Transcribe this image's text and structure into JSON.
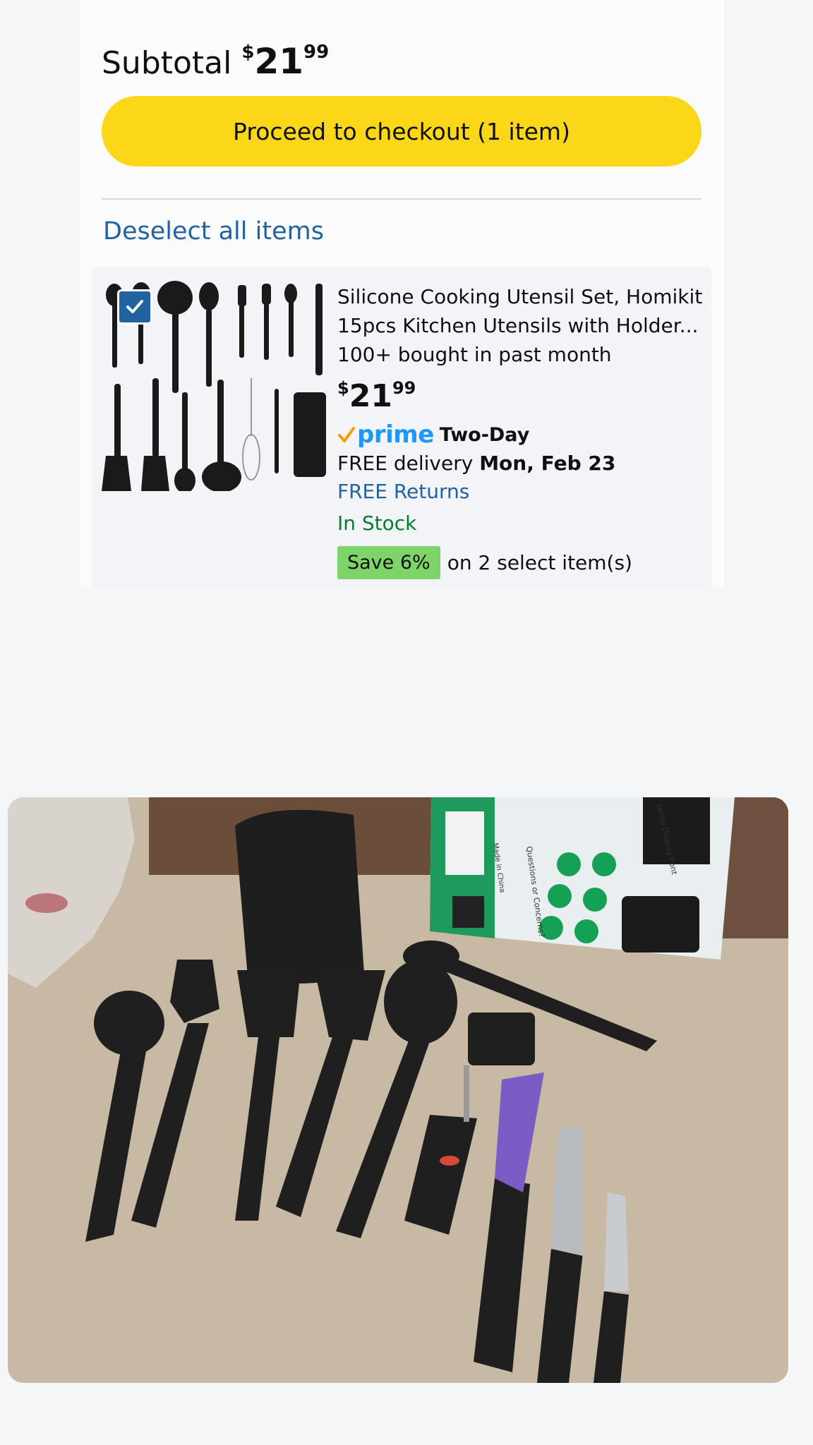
{
  "cart": {
    "subtotal_label": "Subtotal",
    "subtotal_currency": "$",
    "subtotal_whole": "21",
    "subtotal_fraction": "99",
    "checkout_button": "Proceed to checkout (1 item)",
    "deselect_link": "Deselect all items"
  },
  "item": {
    "selected": true,
    "title": "Silicone Cooking Utensil Set, Homikit 15pcs Kitchen Utensils with Holder...",
    "bought": "100+ bought in past month",
    "price_currency": "$",
    "price_whole": "21",
    "price_fraction": "99",
    "prime_label": "prime",
    "shipping_speed": "Two-Day",
    "delivery_prefix": "FREE delivery",
    "delivery_date": "Mon, Feb 23",
    "returns": "FREE Returns",
    "stock": "In Stock",
    "save_badge": "Save 6%",
    "save_text": "on 2 select item(s)"
  },
  "photo_box_text": {
    "line1": "Large Display Font",
    "line2": "Questions or Concerns?",
    "line3": "Made in China"
  },
  "colors": {
    "checkout_button": "#fcd719",
    "link": "#2162a1",
    "in_stock": "#067d2f",
    "save_badge": "#7fd469",
    "prime": "#1a98ff"
  }
}
